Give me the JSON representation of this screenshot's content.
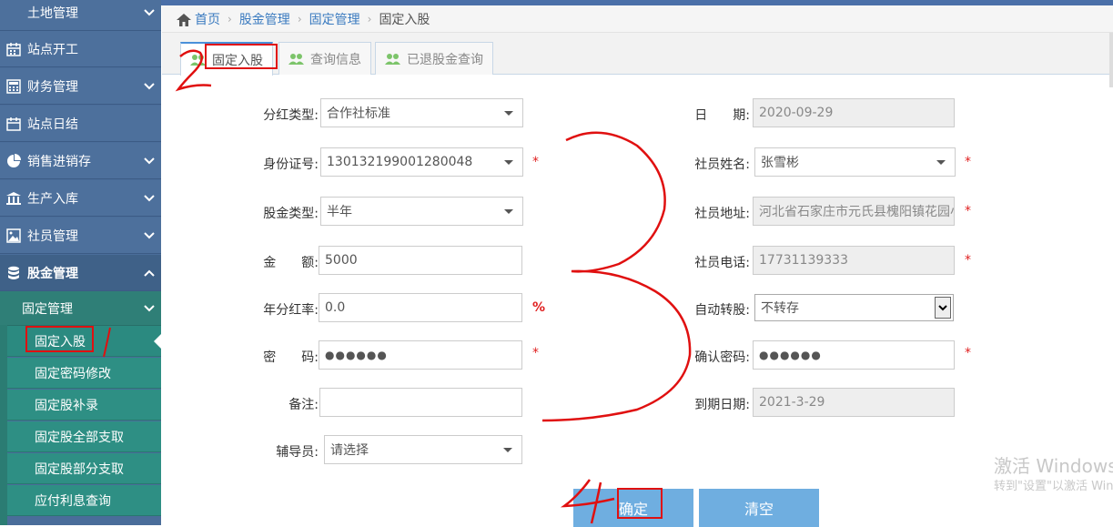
{
  "sidebar": {
    "items": [
      {
        "label": "土地管理",
        "icon": "land-icon",
        "has_chevron": true
      },
      {
        "label": "站点开工",
        "icon": "calendar-icon",
        "has_chevron": false
      },
      {
        "label": "财务管理",
        "icon": "calculator-icon",
        "has_chevron": true
      },
      {
        "label": "站点日结",
        "icon": "calendar-icon",
        "has_chevron": false
      },
      {
        "label": "销售进销存",
        "icon": "pie-chart-icon",
        "has_chevron": true
      },
      {
        "label": "生产入库",
        "icon": "bank-icon",
        "has_chevron": true
      },
      {
        "label": "社员管理",
        "icon": "picture-icon",
        "has_chevron": true
      },
      {
        "label": "股金管理",
        "icon": "database-icon",
        "has_chevron": true
      }
    ],
    "submenu": {
      "label": "固定管理"
    },
    "leaves": [
      {
        "label": "固定入股"
      },
      {
        "label": "固定密码修改"
      },
      {
        "label": "固定股补录"
      },
      {
        "label": "固定股全部支取"
      },
      {
        "label": "固定股部分支取"
      },
      {
        "label": "应付利息查询"
      }
    ]
  },
  "breadcrumb": {
    "home": "首页",
    "level1": "股金管理",
    "level2": "固定管理",
    "current": "固定入股"
  },
  "tabs": [
    {
      "label": "固定入股"
    },
    {
      "label": "查询信息"
    },
    {
      "label": "已退股金查询"
    }
  ],
  "form": {
    "dividend_type_label": "分红类型:",
    "dividend_type_value": "合作社标准",
    "id_number_label": "身份证号:",
    "id_number_value": "130132199001280048",
    "share_type_label": "股金类型:",
    "share_type_value": "半年",
    "amount_label": "金　　额:",
    "amount_value": "5000",
    "annual_rate_label": "年分红率:",
    "annual_rate_value": "0.0",
    "rate_unit": "%",
    "password_label": "密　　码:",
    "password_value": "●●●●●●",
    "remark_label": "备注:",
    "remark_value": "",
    "advisor_label": "辅导员:",
    "advisor_value": "请选择",
    "date_label": "日　　期:",
    "date_value": "2020-09-29",
    "member_name_label": "社员姓名:",
    "member_name_value": "张雪彬",
    "member_address_label": "社员地址:",
    "member_address_value": "河北省石家庄市元氏县槐阳镇花园小区",
    "member_phone_label": "社员电话:",
    "member_phone_value": "17731139333",
    "auto_convert_label": "自动转股:",
    "auto_convert_value": "不转存",
    "confirm_password_label": "确认密码:",
    "confirm_password_value": "●●●●●●",
    "expiry_label": "到期日期:",
    "expiry_value": "2021-3-29",
    "required_mark": "*"
  },
  "buttons": {
    "confirm": "确定",
    "clear": "清空"
  },
  "watermark": {
    "line1": "激活 Windows",
    "line2": "转到\"设置\"以激活 Windows。"
  },
  "colors": {
    "sidebar_blue": "#4d709c",
    "sidebar_teal": "#2e8f84",
    "link_blue": "#3b7bc0",
    "button_blue": "#6faee0",
    "required_red": "#e02020",
    "annotation_red": "#e01010"
  }
}
